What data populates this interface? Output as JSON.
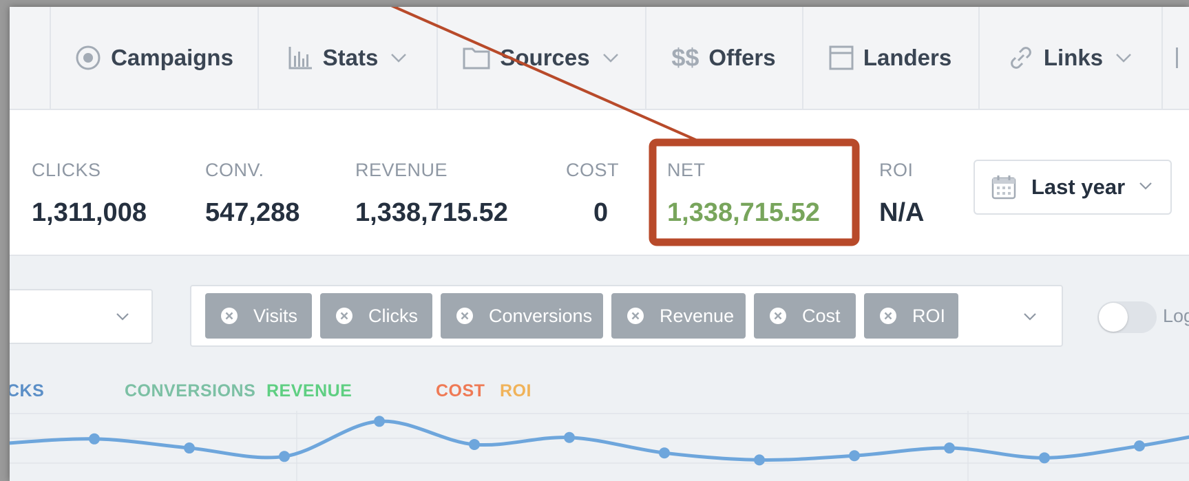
{
  "nav": {
    "items": [
      {
        "label": "Campaigns",
        "icon": "target-icon"
      },
      {
        "label": "Stats",
        "icon": "bar-chart-icon",
        "dropdown": true
      },
      {
        "label": "Sources",
        "icon": "folder-icon",
        "dropdown": true
      },
      {
        "label": "Offers",
        "icon": "dollar-icon",
        "icon_text": "$$"
      },
      {
        "label": "Landers",
        "icon": "window-icon"
      },
      {
        "label": "Links",
        "icon": "link-icon",
        "dropdown": true
      }
    ]
  },
  "stats": {
    "clicks": {
      "label": "CLICKS",
      "value": "1,311,008"
    },
    "conversions": {
      "label": "CONV.",
      "value": "547,288"
    },
    "revenue": {
      "label": "REVENUE",
      "value": "1,338,715.52"
    },
    "cost": {
      "label": "COST",
      "value": "0"
    },
    "net": {
      "label": "NET",
      "value": "1,338,715.52"
    },
    "roi": {
      "label": "ROI",
      "value": "N/A"
    }
  },
  "date_range": {
    "selected": "Last year"
  },
  "metric_tags": [
    "Visits",
    "Clicks",
    "Conversions",
    "Revenue",
    "Cost",
    "ROI"
  ],
  "toggle": {
    "label": "Loga",
    "on": false
  },
  "legend": [
    {
      "label": "CKS",
      "color": "#5b8fc7"
    },
    {
      "label": "CONVERSIONS",
      "color": "#7cc0a4"
    },
    {
      "label": "REVENUE",
      "color": "#5fcf82"
    },
    {
      "label": "COST",
      "color": "#ef7a55"
    },
    {
      "label": "ROI",
      "color": "#f0b35a"
    }
  ],
  "colors": {
    "accent_line": "#6ea6dc",
    "net_value": "#78a55c",
    "highlight": "#b84a2a"
  },
  "chart_data": {
    "type": "line",
    "series": [
      {
        "values": [
          0.53,
          0.6,
          0.47,
          0.35,
          0.85,
          0.52,
          0.62,
          0.4,
          0.3,
          0.36,
          0.47,
          0.33,
          0.5,
          0.75
        ]
      }
    ]
  }
}
